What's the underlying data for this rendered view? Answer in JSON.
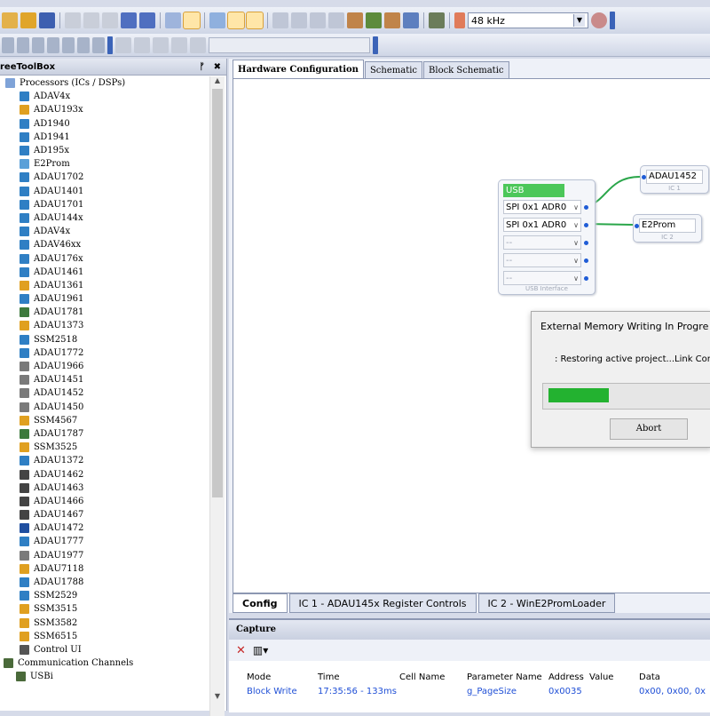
{
  "toolbar": {
    "sample_rate": "48 kHz"
  },
  "toolbox": {
    "title": "reeToolBox",
    "pin": "p",
    "close": "✖",
    "root_label": "Processors (ICs / DSPs)",
    "items": [
      "ADAV4x",
      "ADAU193x",
      "AD1940",
      "AD1941",
      "AD195x",
      "E2Prom",
      "ADAU1702",
      "ADAU1401",
      "ADAU1701",
      "ADAU144x",
      "ADAV4x",
      "ADAV46xx",
      "ADAU176x",
      "ADAU1461",
      "ADAU1361",
      "ADAU1961",
      "ADAU1781",
      "ADAU1373",
      "SSM2518",
      "ADAU1772",
      "ADAU1966",
      "ADAU1451",
      "ADAU1452",
      "ADAU1450",
      "SSM4567",
      "ADAU1787",
      "SSM3525",
      "ADAU1372",
      "ADAU1462",
      "ADAU1463",
      "ADAU1466",
      "ADAU1467",
      "ADAU1472",
      "ADAU1777",
      "ADAU1977",
      "ADAU7118",
      "ADAU1788",
      "SSM2529",
      "SSM3515",
      "SSM3582",
      "SSM6515",
      "Control UI"
    ],
    "comm_label": "Communication Channels",
    "usb_label": "USBi"
  },
  "doc_tabs": [
    "Hardware Configuration",
    "Schematic",
    "Block Schematic"
  ],
  "bottom_tabs": [
    "Config",
    "IC 1 - ADAU145x Register Controls",
    "IC 2 - WinE2PromLoader"
  ],
  "usb_block": {
    "title": "USB",
    "ports": [
      "SPI 0x1 ADR0",
      "SPI 0x1 ADR0",
      "--",
      "--",
      "--"
    ],
    "caption": "USB Interface"
  },
  "ic1": {
    "title": "ADAU1452",
    "caption": "IC 1"
  },
  "ic2": {
    "title": "E2Prom",
    "caption": "IC 2"
  },
  "dialog": {
    "title": "External Memory Writing In Progre",
    "message": ": Restoring active project...Link Comp",
    "progress": 0.38,
    "abort": "Abort"
  },
  "capture": {
    "title": "Capture",
    "columns": [
      "Mode",
      "Time",
      "Cell Name",
      "Parameter Name",
      "Address",
      "Value",
      "Data"
    ],
    "rows": [
      [
        "Block Write",
        "17:35:56 - 133ms",
        "",
        "g_PageSize",
        "0x0035",
        "",
        "0x00, 0x00, 0x"
      ]
    ]
  },
  "colors": {
    "usb_green": "#4cc75a",
    "progress_green": "#23b230",
    "wire_green": "#2aa64a",
    "port_blue": "#1f5cd6"
  }
}
